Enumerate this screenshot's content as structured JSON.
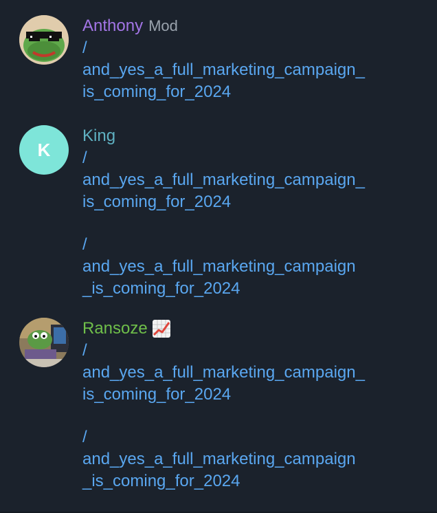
{
  "messages": [
    {
      "author": "Anthony",
      "author_color": "#a375e6",
      "role": "Mod",
      "avatar": "frog-with-sunglasses-avatar",
      "links": [
        "/and_yes_a_full_marketing_campaign_is_coming_for_2024"
      ]
    },
    {
      "author": "King",
      "author_color": "#5fb1c2",
      "avatar_letter": "K",
      "avatar_color": "#7ee5d9",
      "links": [
        "/and_yes_a_full_marketing_campaign_is_coming_for_2024",
        "/and_yes_a_full_marketing_campaign_is_coming_for_2024"
      ]
    },
    {
      "author": "Ransoze",
      "author_color": "#6fbf4a",
      "avatar": "frog-at-desk-avatar",
      "emoji": "chart-increasing-icon",
      "links": [
        "/and_yes_a_full_marketing_campaign_is_coming_for_2024",
        "/and_yes_a_full_marketing_campaign_is_coming_for_2024"
      ]
    }
  ],
  "display": {
    "m0_link0": [
      "/",
      "and_yes_a_full_marketing_campaign_",
      "is_coming_for_2024"
    ],
    "m1_link0": [
      "/",
      "and_yes_a_full_marketing_campaign_",
      "is_coming_for_2024"
    ],
    "m1_link1": [
      "/",
      "and_yes_a_full_marketing_campaign",
      "_is_coming_for_2024"
    ],
    "m2_link0": [
      "/",
      "and_yes_a_full_marketing_campaign_",
      "is_coming_for_2024"
    ],
    "m2_link1": [
      "/",
      "and_yes_a_full_marketing_campaign",
      "_is_coming_for_2024"
    ]
  }
}
